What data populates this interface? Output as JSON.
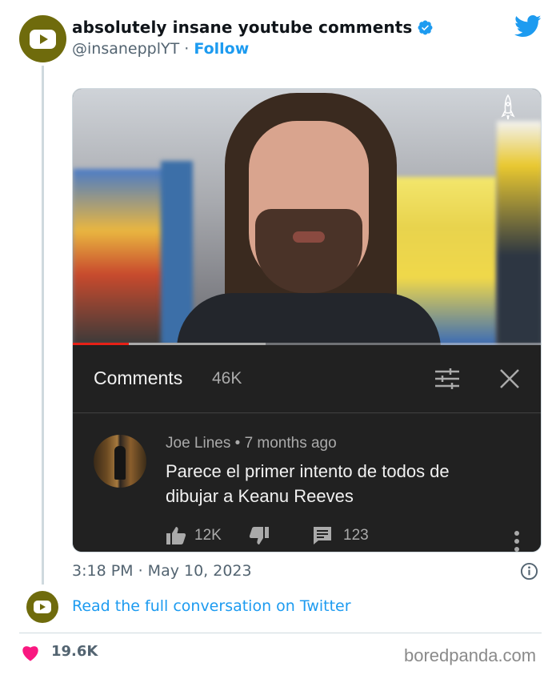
{
  "tweet": {
    "display_name": "absolutely insane youtube comments",
    "handle": "@insanepplYT",
    "separator": "·",
    "follow_label": "Follow",
    "timestamp": "3:18 PM · May 10, 2023",
    "read_more_label": "Read the full conversation on Twitter",
    "like_count": "19.6K",
    "avatar_color": "#6f6b0c",
    "accent_color": "#1d9bf0",
    "heart_color": "#f91880"
  },
  "embedded": {
    "comments_title": "Comments",
    "comments_count": "46K",
    "comment": {
      "author": "Joe Lines",
      "dot": "•",
      "age": "7 months ago",
      "text": "Parece el primer intento de todos de dibujar a Keanu Reeves",
      "likes": "12K",
      "replies": "123"
    },
    "progress_fraction": 0.12,
    "buffer_fraction": 0.41
  },
  "watermark": "boredpanda.com",
  "icons": [
    "youtube-logo-icon",
    "verified-badge-icon",
    "twitter-bird-icon",
    "rocket-icon",
    "filter-icon",
    "close-icon",
    "thumbs-up-icon",
    "thumbs-down-icon",
    "reply-icon",
    "more-vertical-icon",
    "info-icon",
    "heart-icon"
  ]
}
